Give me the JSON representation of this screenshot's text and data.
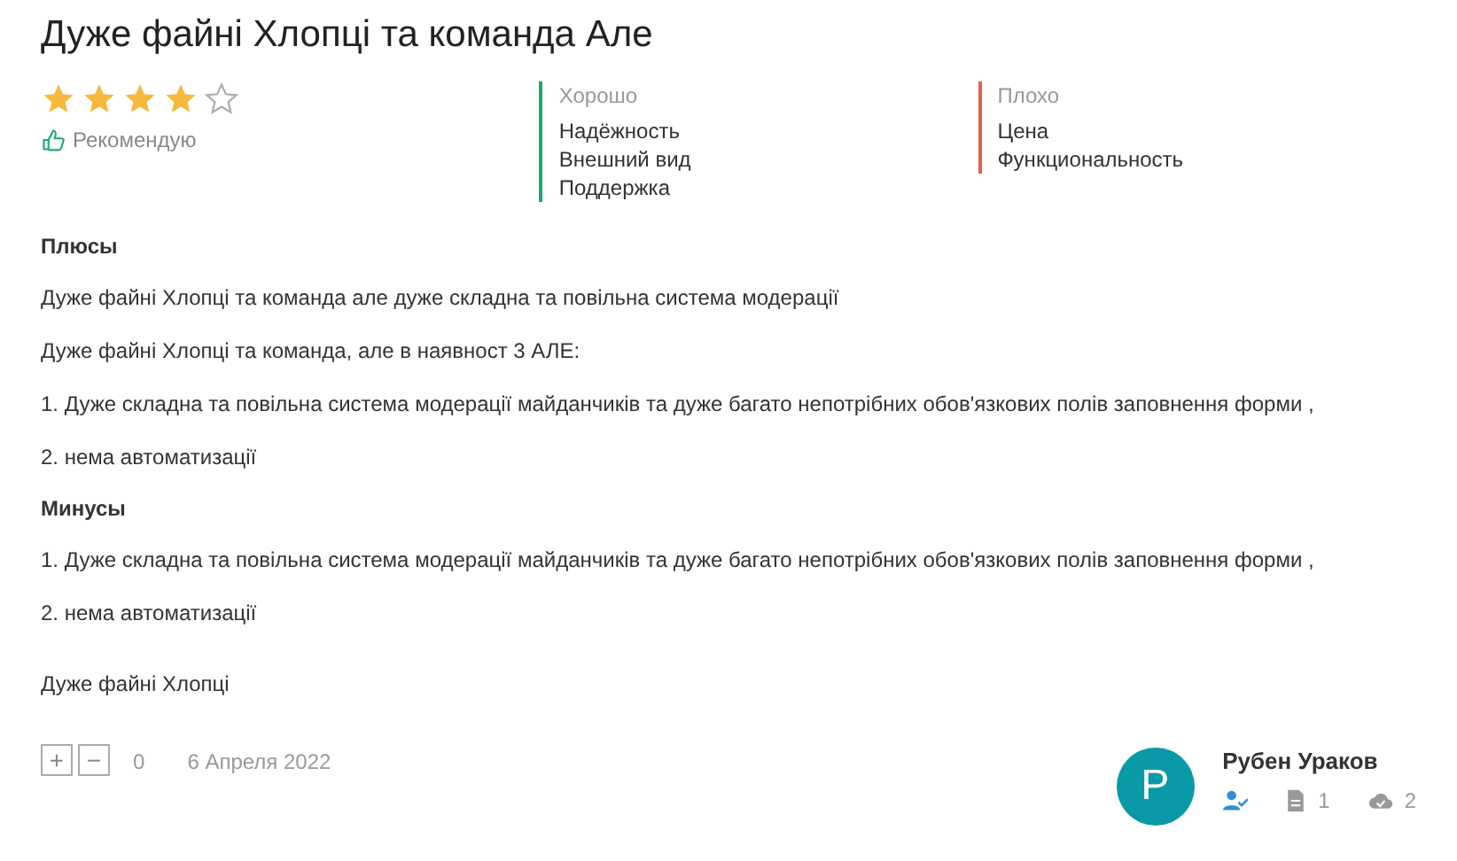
{
  "title": "Дуже файні Хлопці та команда Але",
  "rating": {
    "stars": 4
  },
  "recommend": {
    "label": "Рекомендую"
  },
  "good": {
    "heading": "Хорошо",
    "items": [
      "Надёжность",
      "Внешний вид",
      "Поддержка"
    ]
  },
  "bad": {
    "heading": "Плохо",
    "items": [
      "Цена",
      "Функциональность"
    ]
  },
  "body": [
    {
      "kind": "heading",
      "text": "Плюсы"
    },
    {
      "kind": "text",
      "text": "Дуже файні Хлопці та команда але дуже складна та повільна система модерації"
    },
    {
      "kind": "text",
      "text": "Дуже файні Хлопці та команда, але в наявност 3 АЛЕ:"
    },
    {
      "kind": "text",
      "text": "1. Дуже складна та повільна система модерації майданчиків та дуже багато непотрібних обов'язкових полів заповнення форми ,"
    },
    {
      "kind": "text",
      "text": "2. нема автоматизації"
    },
    {
      "kind": "heading",
      "text": "Минусы"
    },
    {
      "kind": "text",
      "text": "1. Дуже складна та повільна система модерації майданчиків та дуже багато непотрібних обов'язкових полів заповнення форми ,"
    },
    {
      "kind": "text",
      "text": "2. нема автоматизації"
    },
    {
      "kind": "gap",
      "text": "Дуже файні Хлопці"
    }
  ],
  "votes": {
    "plus": "+",
    "minus": "−",
    "count": "0"
  },
  "date": "6 Апреля 2022",
  "author": {
    "initial": "Р",
    "name": "Рубен Ураков",
    "reviews": "1",
    "likes": "2"
  }
}
